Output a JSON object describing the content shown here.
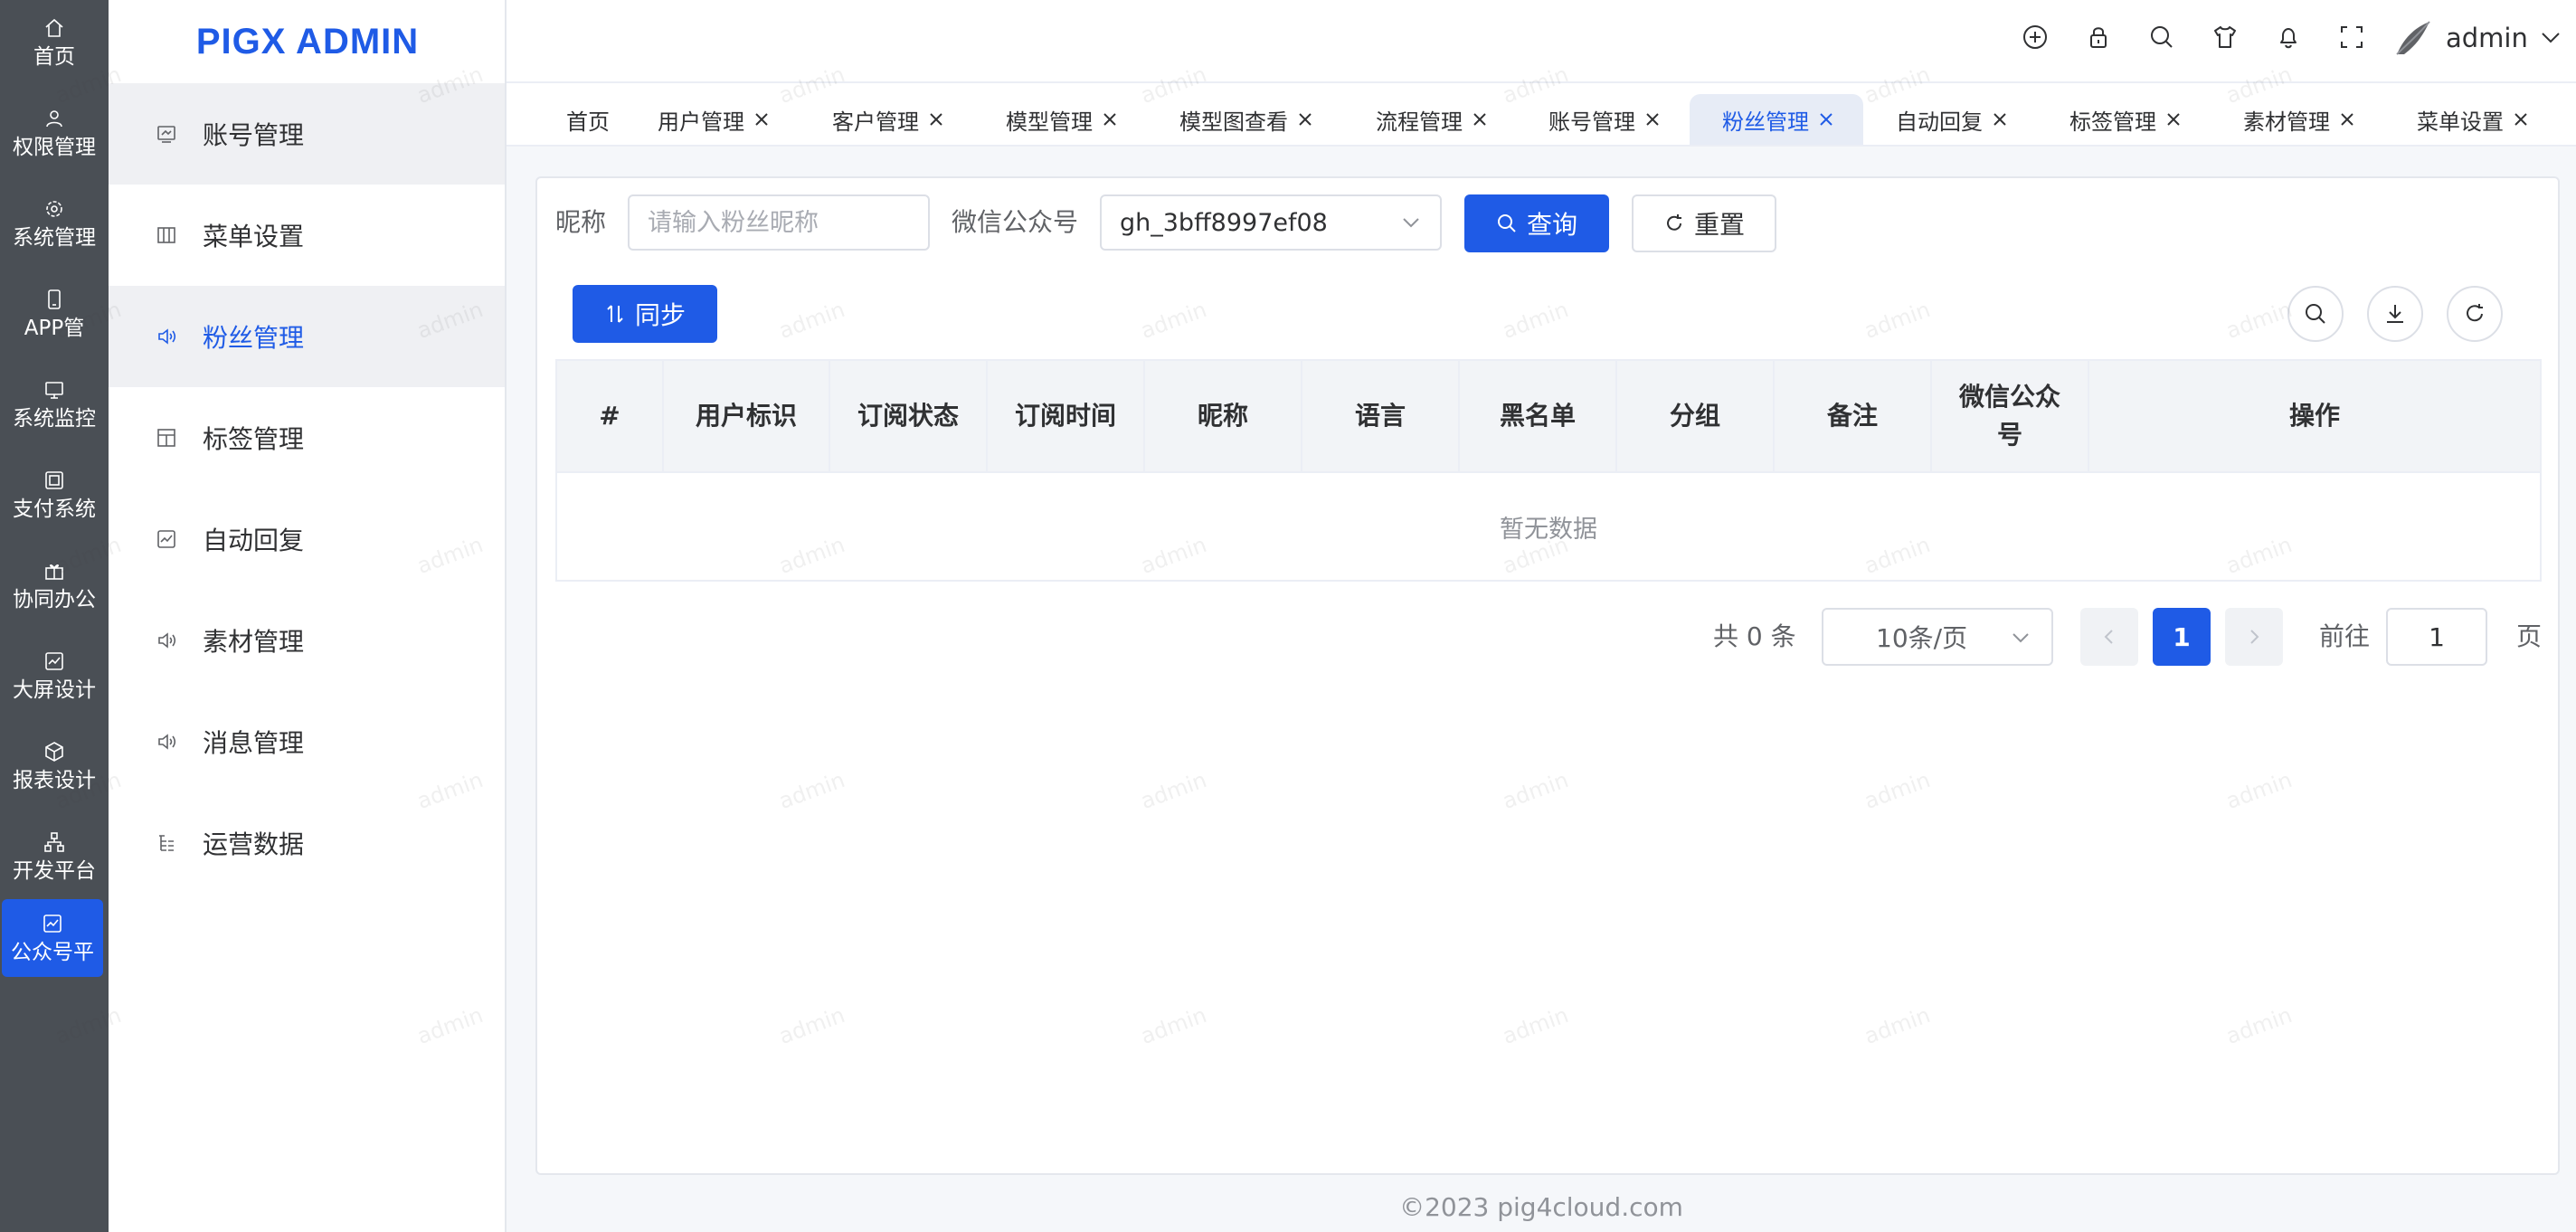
{
  "rail": {
    "items": [
      {
        "label": "首页",
        "icon": "home-icon"
      },
      {
        "label": "权限管理",
        "icon": "user-icon"
      },
      {
        "label": "系统管理",
        "icon": "settings-icon"
      },
      {
        "label": "APP管",
        "icon": "mobile-icon"
      },
      {
        "label": "系统监控",
        "icon": "monitor-icon"
      },
      {
        "label": "支付系统",
        "icon": "payment-icon"
      },
      {
        "label": "协同办公",
        "icon": "gift-icon"
      },
      {
        "label": "大屏设计",
        "icon": "chart-icon"
      },
      {
        "label": "报表设计",
        "icon": "box-icon"
      },
      {
        "label": "开发平台",
        "icon": "sitemap-icon"
      },
      {
        "label": "公众号平",
        "icon": "chart-line-icon"
      }
    ]
  },
  "sidebar": {
    "brand": "PIGX ADMIN",
    "items": [
      {
        "label": "账号管理",
        "icon": "account-icon"
      },
      {
        "label": "菜单设置",
        "icon": "columns-icon"
      },
      {
        "label": "粉丝管理",
        "icon": "speaker-icon"
      },
      {
        "label": "标签管理",
        "icon": "layout-icon"
      },
      {
        "label": "自动回复",
        "icon": "chart-icon"
      },
      {
        "label": "素材管理",
        "icon": "speaker-icon"
      },
      {
        "label": "消息管理",
        "icon": "speaker-icon"
      },
      {
        "label": "运营数据",
        "icon": "list-tree-icon"
      }
    ]
  },
  "header": {
    "icons": [
      "language-icon",
      "lock-icon",
      "search-icon",
      "theme-shirt-icon",
      "bell-icon",
      "fullscreen-icon"
    ],
    "user": "admin"
  },
  "tags": [
    {
      "label": "首页",
      "closable": false
    },
    {
      "label": "用户管理",
      "closable": true
    },
    {
      "label": "客户管理",
      "closable": true
    },
    {
      "label": "模型管理",
      "closable": true
    },
    {
      "label": "模型图查看",
      "closable": true
    },
    {
      "label": "流程管理",
      "closable": true
    },
    {
      "label": "账号管理",
      "closable": true
    },
    {
      "label": "粉丝管理",
      "closable": true
    },
    {
      "label": "自动回复",
      "closable": true
    },
    {
      "label": "标签管理",
      "closable": true
    },
    {
      "label": "素材管理",
      "closable": true
    },
    {
      "label": "菜单设置",
      "closable": true
    }
  ],
  "search": {
    "nickname_label": "昵称",
    "nickname_placeholder": "请输入粉丝昵称",
    "account_label": "微信公众号",
    "account_value": "gh_3bff8997ef08",
    "query_label": "查询",
    "reset_label": "重置"
  },
  "toolbar": {
    "sync_label": "同步"
  },
  "table": {
    "columns": [
      "#",
      "用户标识",
      "订阅状态",
      "订阅时间",
      "昵称",
      "语言",
      "黑名单",
      "分组",
      "备注",
      "微信公众号",
      "操作"
    ],
    "empty_text": "暂无数据"
  },
  "pagination": {
    "total_text": "共 0 条",
    "page_size": "10条/页",
    "current_page": "1",
    "goto_label": "前往",
    "goto_value": "1",
    "page_suffix": "页"
  },
  "footer": "©2023 pig4cloud.com",
  "watermark": "admin",
  "colors": {
    "primary": "#1f5be6",
    "rail": "#4a4f55"
  }
}
